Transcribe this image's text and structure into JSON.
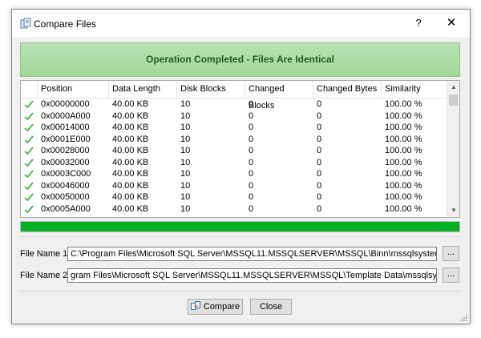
{
  "window": {
    "title": "Compare Files",
    "help_label": "?",
    "close_label": "✕"
  },
  "banner": {
    "text": "Operation Completed - Files Are Identical"
  },
  "table": {
    "columns": [
      "Position",
      "Data Length",
      "Disk Blocks",
      "Changed Blocks",
      "Changed Bytes",
      "Similarity"
    ],
    "rows": [
      [
        "0x00000000",
        "40.00 KB",
        "10",
        "0",
        "0",
        "100.00 %"
      ],
      [
        "0x0000A000",
        "40.00 KB",
        "10",
        "0",
        "0",
        "100.00 %"
      ],
      [
        "0x00014000",
        "40.00 KB",
        "10",
        "0",
        "0",
        "100.00 %"
      ],
      [
        "0x0001E000",
        "40.00 KB",
        "10",
        "0",
        "0",
        "100.00 %"
      ],
      [
        "0x00028000",
        "40.00 KB",
        "10",
        "0",
        "0",
        "100.00 %"
      ],
      [
        "0x00032000",
        "40.00 KB",
        "10",
        "0",
        "0",
        "100.00 %"
      ],
      [
        "0x0003C000",
        "40.00 KB",
        "10",
        "0",
        "0",
        "100.00 %"
      ],
      [
        "0x00046000",
        "40.00 KB",
        "10",
        "0",
        "0",
        "100.00 %"
      ],
      [
        "0x00050000",
        "40.00 KB",
        "10",
        "0",
        "0",
        "100.00 %"
      ],
      [
        "0x0005A000",
        "40.00 KB",
        "10",
        "0",
        "0",
        "100.00 %"
      ]
    ]
  },
  "progress": {
    "fraction": 1.0
  },
  "files": {
    "file1_label": "File Name 1:",
    "file1_value": "C:\\Program Files\\Microsoft SQL Server\\MSSQL11.MSSQLSERVER\\MSSQL\\Binn\\mssqlsystemresource.mdf",
    "file2_label": "File Name 2:",
    "file2_value": "gram Files\\Microsoft SQL Server\\MSSQL11.MSSQLSERVER\\MSSQL\\Template Data\\mssqlsystemresource.mdf",
    "browse_label": "..."
  },
  "buttons": {
    "compare": "Compare",
    "close": "Close"
  },
  "colors": {
    "banner_bg": "#a3d79a",
    "banner_text": "#1f5a1f",
    "progress": "#06b025",
    "check": "#4caf50"
  }
}
